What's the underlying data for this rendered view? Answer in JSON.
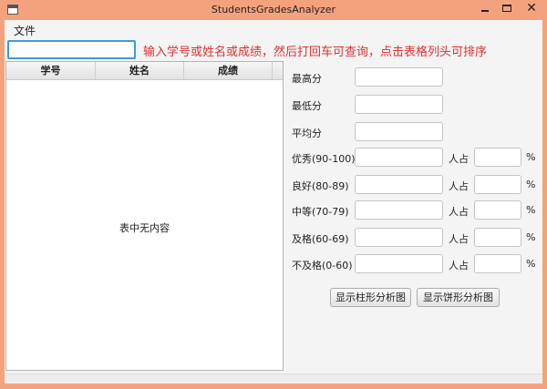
{
  "window": {
    "title": "StudentsGradesAnalyzer",
    "close_symbol": "✕"
  },
  "menu": {
    "file_label": "文件"
  },
  "search": {
    "value": "",
    "hint": "输入学号或姓名或成绩，然后打回车可查询，点击表格列头可排序"
  },
  "table": {
    "columns": [
      "学号",
      "姓名",
      "成绩"
    ],
    "empty_message": "表中无内容"
  },
  "stats": {
    "max_label": "最高分",
    "min_label": "最低分",
    "avg_label": "平均分",
    "count_label": "人占",
    "percent_sign": "%",
    "grades": [
      {
        "label": "优秀(90-100)"
      },
      {
        "label": "良好(80-89)"
      },
      {
        "label": "中等(70-79)"
      },
      {
        "label": "及格(60-69)"
      },
      {
        "label": "不及格(0-60)"
      }
    ]
  },
  "buttons": {
    "bar_chart_label": "显示柱形分析图",
    "pie_chart_label": "显示饼形分析图"
  },
  "colors": {
    "window_frame": "#f4a27e",
    "hint_text": "#e03030",
    "focus_border": "#3c9bd6"
  }
}
